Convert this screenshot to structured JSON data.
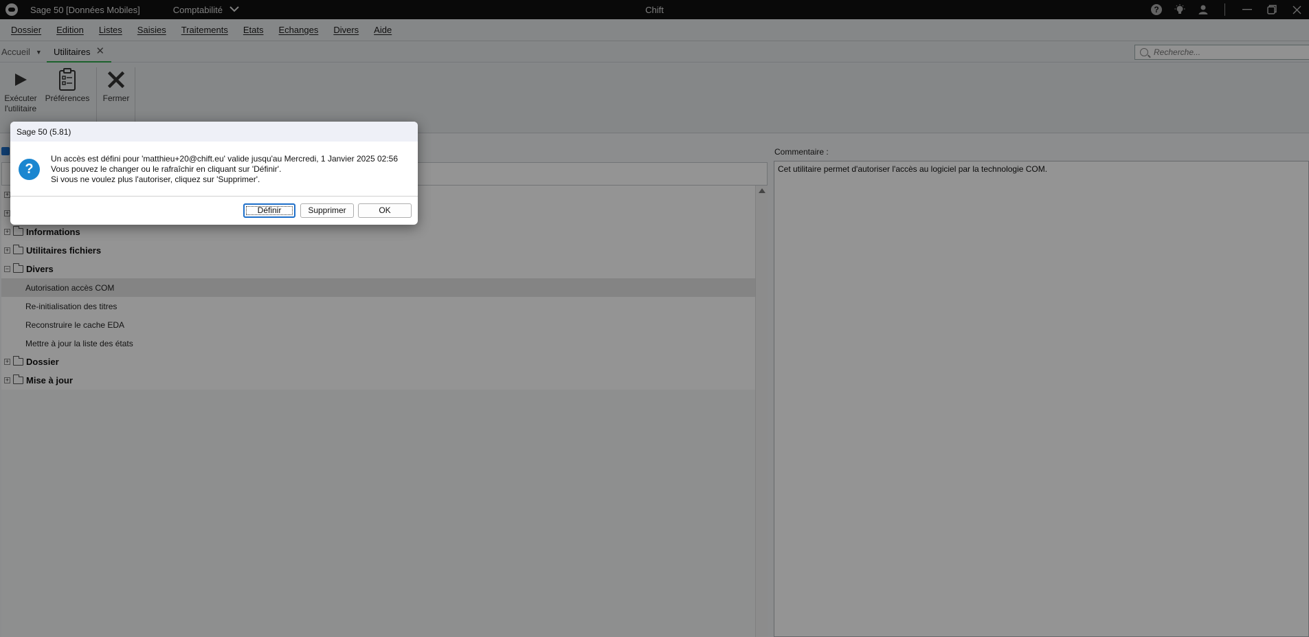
{
  "titlebar": {
    "app_title": "Sage 50 [Données Mobiles]",
    "module": "Comptabilité",
    "center_title": "Chift"
  },
  "menu": {
    "items": [
      "Dossier",
      "Edition",
      "Listes",
      "Saisies",
      "Traitements",
      "Etats",
      "Echanges",
      "Divers",
      "Aide"
    ]
  },
  "tabs": {
    "home": "Accueil",
    "active": "Utilitaires"
  },
  "search": {
    "placeholder": "Recherche..."
  },
  "ribbon": {
    "execute_line1": "Exécuter",
    "execute_line2": "l'utilitaire",
    "preferences": "Préférences",
    "close": "Fermer"
  },
  "comment": {
    "label": "Commentaire :",
    "text": "Cet utilitaire permet d'autoriser l'accès au logiciel par la technologie COM."
  },
  "tree": {
    "groups": {
      "informations": "Informations",
      "utilitaires_fichiers": "Utilitaires fichiers",
      "divers": "Divers",
      "dossier": "Dossier",
      "mise_a_jour": "Mise à jour"
    },
    "divers_items": [
      "Autorisation accès COM",
      "Re-initialisation des titres",
      "Reconstruire le cache EDA",
      "Mettre à jour la liste des états"
    ],
    "expand_sign": "+",
    "collapse_sign": "−"
  },
  "dialog": {
    "title": "Sage 50 (5.81)",
    "line1": "Un accès est défini pour 'matthieu+20@chift.eu' valide jusqu'au Mercredi, 1 Janvier 2025 02:56",
    "line2": "Vous pouvez le changer ou le rafraîchir en cliquant sur 'Définir'.",
    "line3": "Si vous ne voulez plus l'autoriser, cliquez sur 'Supprimer'.",
    "btn_define": "Définir",
    "btn_delete": "Supprimer",
    "btn_ok": "OK"
  }
}
